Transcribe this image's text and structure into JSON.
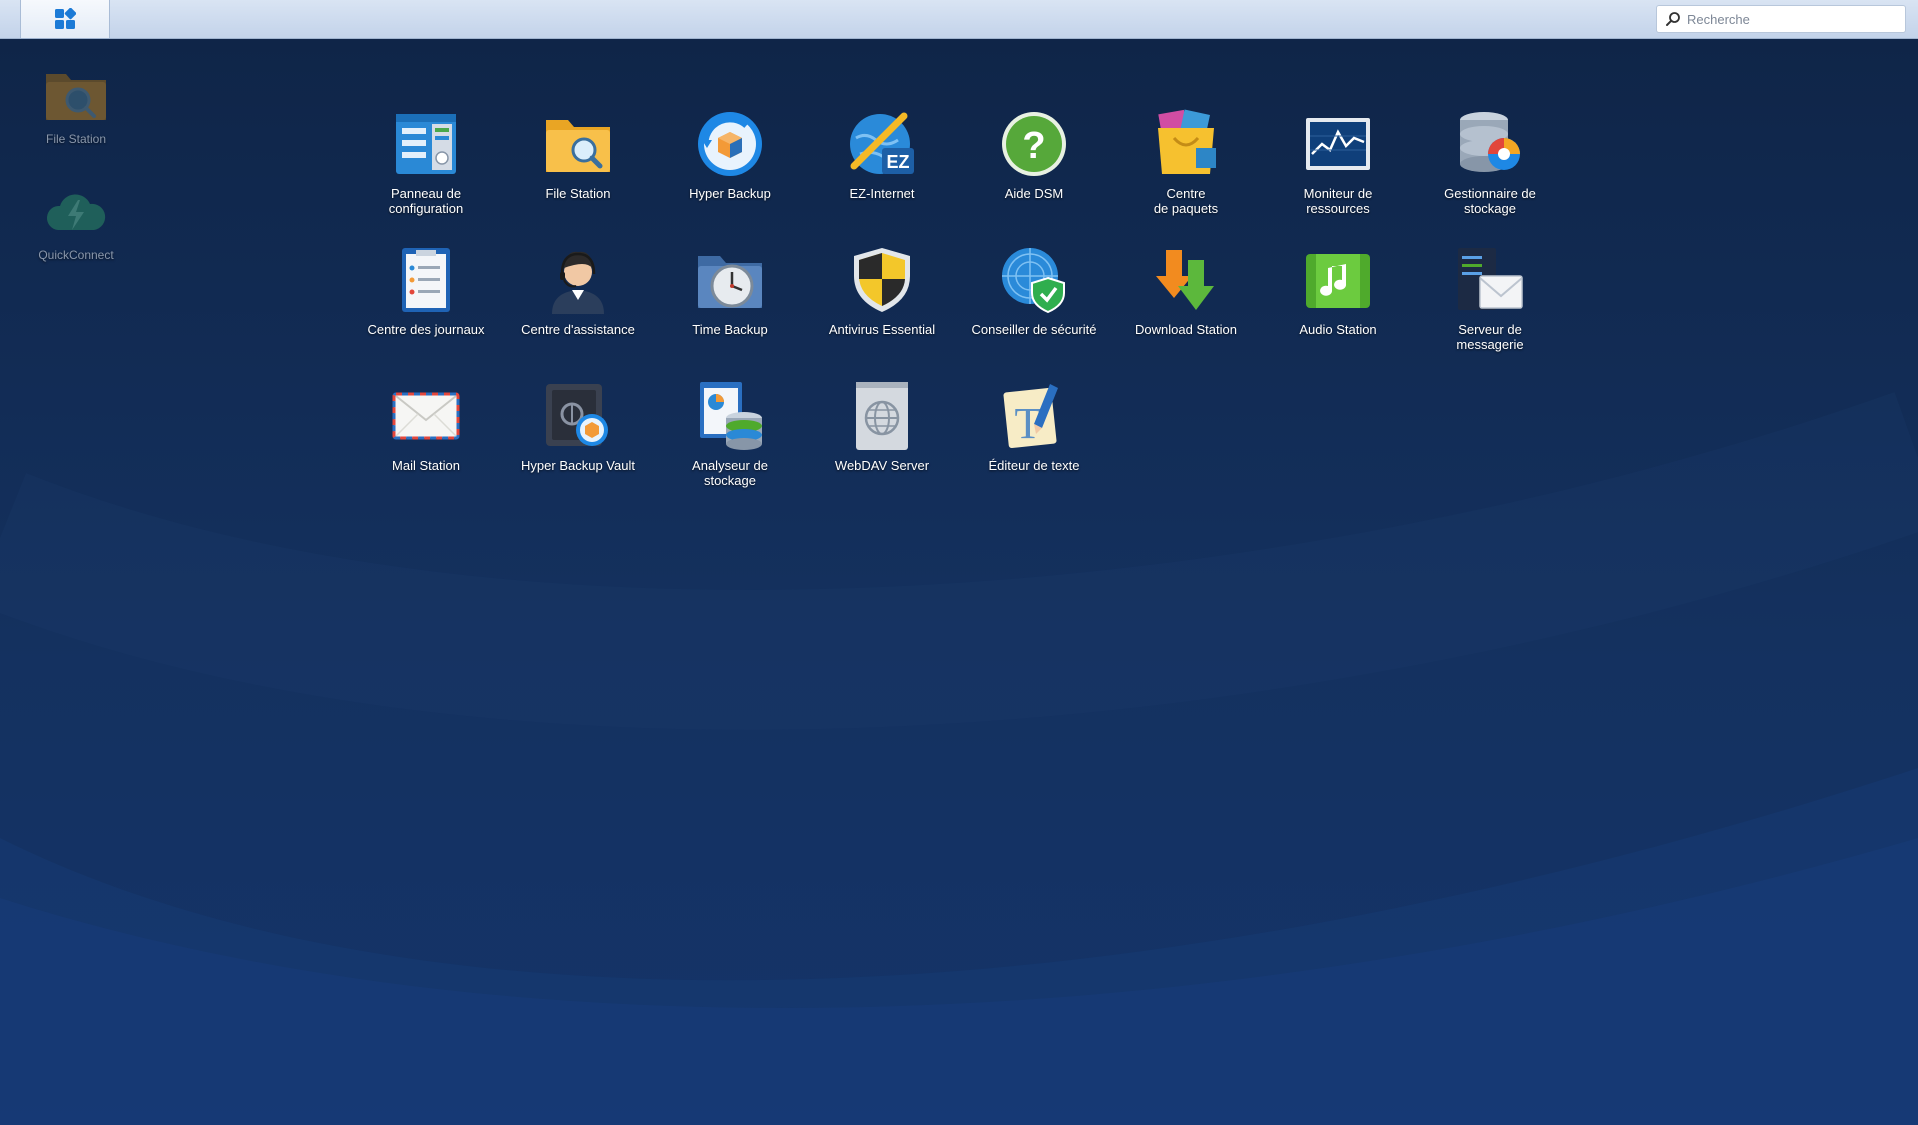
{
  "taskbar": {
    "main_menu_icon": "grid-icon",
    "search": {
      "placeholder": "Recherche",
      "value": ""
    }
  },
  "desktop_shortcuts": [
    {
      "label": "File Station",
      "icon": "folder-search-icon"
    },
    {
      "label": "QuickConnect",
      "icon": "quickconnect-icon"
    }
  ],
  "apps": [
    {
      "label": "Panneau de\nconfiguration",
      "icon": "control-panel-icon"
    },
    {
      "label": "File Station",
      "icon": "folder-search-icon"
    },
    {
      "label": "Hyper Backup",
      "icon": "hyper-backup-icon"
    },
    {
      "label": "EZ-Internet",
      "icon": "ez-internet-icon"
    },
    {
      "label": "Aide DSM",
      "icon": "help-icon"
    },
    {
      "label": "Centre\nde paquets",
      "icon": "package-center-icon"
    },
    {
      "label": "Moniteur de\nressources",
      "icon": "resource-monitor-icon"
    },
    {
      "label": "Gestionnaire de\nstockage",
      "icon": "storage-manager-icon"
    },
    {
      "label": "Centre des journaux",
      "icon": "log-center-icon"
    },
    {
      "label": "Centre d'assistance",
      "icon": "support-center-icon"
    },
    {
      "label": "Time Backup",
      "icon": "time-backup-icon"
    },
    {
      "label": "Antivirus Essential",
      "icon": "antivirus-icon"
    },
    {
      "label": "Conseiller de sécurité",
      "icon": "security-advisor-icon"
    },
    {
      "label": "Download Station",
      "icon": "download-station-icon"
    },
    {
      "label": "Audio Station",
      "icon": "audio-station-icon"
    },
    {
      "label": "Serveur de\nmessagerie",
      "icon": "mail-server-icon"
    },
    {
      "label": "Mail Station",
      "icon": "mail-station-icon"
    },
    {
      "label": "Hyper Backup Vault",
      "icon": "hyper-backup-vault-icon"
    },
    {
      "label": "Analyseur de\nstockage",
      "icon": "storage-analyzer-icon"
    },
    {
      "label": "WebDAV Server",
      "icon": "webdav-server-icon"
    },
    {
      "label": "Éditeur de texte",
      "icon": "text-editor-icon"
    }
  ],
  "colors": {
    "desktop_bg": "#10264b",
    "taskbar_bg": "#c3d3ea",
    "label_text": "#ffffff",
    "shortcut_label": "#8a97ab"
  }
}
